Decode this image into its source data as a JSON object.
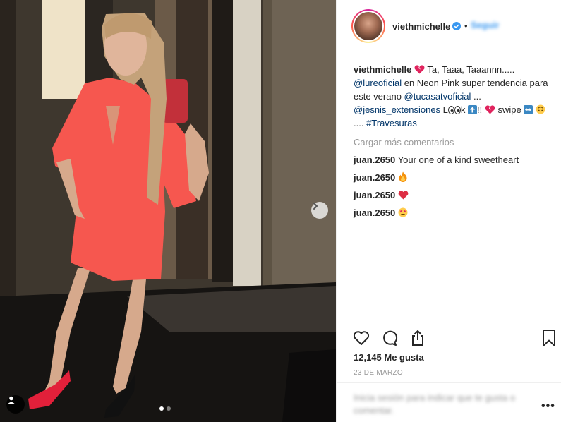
{
  "post": {
    "username": "viethmichelle",
    "follow_label": "Seguir",
    "header_separator": "•"
  },
  "caption": {
    "username": "viethmichelle",
    "text_1": " Ta, Taaa, Taaannn.....",
    "mention_1": "@lureoficial",
    "text_2": " en Neon Pink super tendencia para este verano ",
    "mention_2": "@tucasatvoficial",
    "text_3": " ...",
    "mention_3": "@jesnis_extensiones",
    "text_4": " L",
    "text_5": "k ",
    "text_6": "!! ",
    "text_7": " swipe ",
    "text_8": ".... ",
    "hashtag": "#Travesuras"
  },
  "load_more": "Cargar más comentarios",
  "comments": [
    {
      "user": "juan.2650",
      "text": "Your one of a kind sweetheart"
    },
    {
      "user": "juan.2650",
      "text": "",
      "emoji": "fire-icon"
    },
    {
      "user": "juan.2650",
      "text": "",
      "emoji": "red-heart-icon"
    },
    {
      "user": "juan.2650",
      "text": "",
      "emoji": "star-struck-icon"
    }
  ],
  "likes": "12,145 Me gusta",
  "date": "23 DE MARZO",
  "add_comment_placeholder": "Inicia sesión para indicar que te gusta o comentar.",
  "more_label": "•••",
  "colors": {
    "link": "#003569",
    "verified": "#3897f0",
    "muted": "#999999",
    "dress": "#f6574f"
  }
}
